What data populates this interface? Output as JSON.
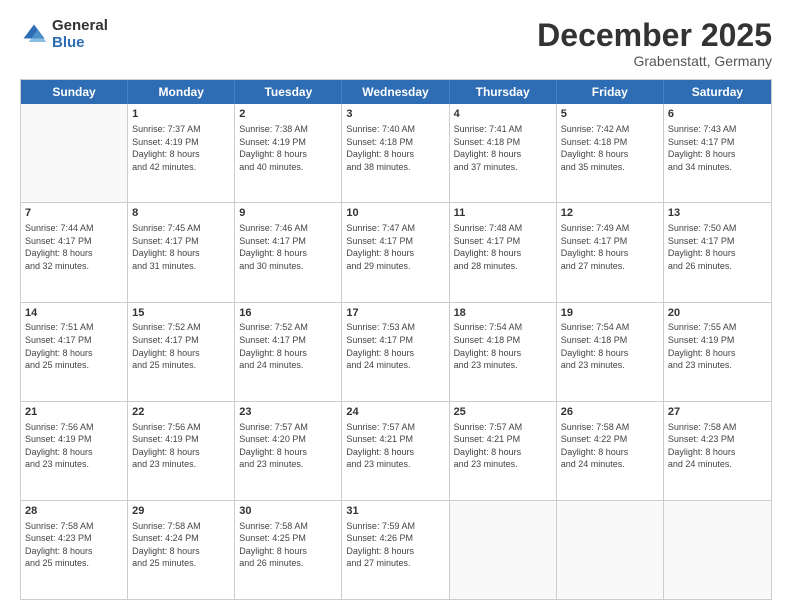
{
  "logo": {
    "general": "General",
    "blue": "Blue"
  },
  "title": "December 2025",
  "subtitle": "Grabenstatt, Germany",
  "header_days": [
    "Sunday",
    "Monday",
    "Tuesday",
    "Wednesday",
    "Thursday",
    "Friday",
    "Saturday"
  ],
  "weeks": [
    [
      {
        "day": "",
        "info": ""
      },
      {
        "day": "1",
        "info": "Sunrise: 7:37 AM\nSunset: 4:19 PM\nDaylight: 8 hours\nand 42 minutes."
      },
      {
        "day": "2",
        "info": "Sunrise: 7:38 AM\nSunset: 4:19 PM\nDaylight: 8 hours\nand 40 minutes."
      },
      {
        "day": "3",
        "info": "Sunrise: 7:40 AM\nSunset: 4:18 PM\nDaylight: 8 hours\nand 38 minutes."
      },
      {
        "day": "4",
        "info": "Sunrise: 7:41 AM\nSunset: 4:18 PM\nDaylight: 8 hours\nand 37 minutes."
      },
      {
        "day": "5",
        "info": "Sunrise: 7:42 AM\nSunset: 4:18 PM\nDaylight: 8 hours\nand 35 minutes."
      },
      {
        "day": "6",
        "info": "Sunrise: 7:43 AM\nSunset: 4:17 PM\nDaylight: 8 hours\nand 34 minutes."
      }
    ],
    [
      {
        "day": "7",
        "info": "Sunrise: 7:44 AM\nSunset: 4:17 PM\nDaylight: 8 hours\nand 32 minutes."
      },
      {
        "day": "8",
        "info": "Sunrise: 7:45 AM\nSunset: 4:17 PM\nDaylight: 8 hours\nand 31 minutes."
      },
      {
        "day": "9",
        "info": "Sunrise: 7:46 AM\nSunset: 4:17 PM\nDaylight: 8 hours\nand 30 minutes."
      },
      {
        "day": "10",
        "info": "Sunrise: 7:47 AM\nSunset: 4:17 PM\nDaylight: 8 hours\nand 29 minutes."
      },
      {
        "day": "11",
        "info": "Sunrise: 7:48 AM\nSunset: 4:17 PM\nDaylight: 8 hours\nand 28 minutes."
      },
      {
        "day": "12",
        "info": "Sunrise: 7:49 AM\nSunset: 4:17 PM\nDaylight: 8 hours\nand 27 minutes."
      },
      {
        "day": "13",
        "info": "Sunrise: 7:50 AM\nSunset: 4:17 PM\nDaylight: 8 hours\nand 26 minutes."
      }
    ],
    [
      {
        "day": "14",
        "info": "Sunrise: 7:51 AM\nSunset: 4:17 PM\nDaylight: 8 hours\nand 25 minutes."
      },
      {
        "day": "15",
        "info": "Sunrise: 7:52 AM\nSunset: 4:17 PM\nDaylight: 8 hours\nand 25 minutes."
      },
      {
        "day": "16",
        "info": "Sunrise: 7:52 AM\nSunset: 4:17 PM\nDaylight: 8 hours\nand 24 minutes."
      },
      {
        "day": "17",
        "info": "Sunrise: 7:53 AM\nSunset: 4:17 PM\nDaylight: 8 hours\nand 24 minutes."
      },
      {
        "day": "18",
        "info": "Sunrise: 7:54 AM\nSunset: 4:18 PM\nDaylight: 8 hours\nand 23 minutes."
      },
      {
        "day": "19",
        "info": "Sunrise: 7:54 AM\nSunset: 4:18 PM\nDaylight: 8 hours\nand 23 minutes."
      },
      {
        "day": "20",
        "info": "Sunrise: 7:55 AM\nSunset: 4:19 PM\nDaylight: 8 hours\nand 23 minutes."
      }
    ],
    [
      {
        "day": "21",
        "info": "Sunrise: 7:56 AM\nSunset: 4:19 PM\nDaylight: 8 hours\nand 23 minutes."
      },
      {
        "day": "22",
        "info": "Sunrise: 7:56 AM\nSunset: 4:19 PM\nDaylight: 8 hours\nand 23 minutes."
      },
      {
        "day": "23",
        "info": "Sunrise: 7:57 AM\nSunset: 4:20 PM\nDaylight: 8 hours\nand 23 minutes."
      },
      {
        "day": "24",
        "info": "Sunrise: 7:57 AM\nSunset: 4:21 PM\nDaylight: 8 hours\nand 23 minutes."
      },
      {
        "day": "25",
        "info": "Sunrise: 7:57 AM\nSunset: 4:21 PM\nDaylight: 8 hours\nand 23 minutes."
      },
      {
        "day": "26",
        "info": "Sunrise: 7:58 AM\nSunset: 4:22 PM\nDaylight: 8 hours\nand 24 minutes."
      },
      {
        "day": "27",
        "info": "Sunrise: 7:58 AM\nSunset: 4:23 PM\nDaylight: 8 hours\nand 24 minutes."
      }
    ],
    [
      {
        "day": "28",
        "info": "Sunrise: 7:58 AM\nSunset: 4:23 PM\nDaylight: 8 hours\nand 25 minutes."
      },
      {
        "day": "29",
        "info": "Sunrise: 7:58 AM\nSunset: 4:24 PM\nDaylight: 8 hours\nand 25 minutes."
      },
      {
        "day": "30",
        "info": "Sunrise: 7:58 AM\nSunset: 4:25 PM\nDaylight: 8 hours\nand 26 minutes."
      },
      {
        "day": "31",
        "info": "Sunrise: 7:59 AM\nSunset: 4:26 PM\nDaylight: 8 hours\nand 27 minutes."
      },
      {
        "day": "",
        "info": ""
      },
      {
        "day": "",
        "info": ""
      },
      {
        "day": "",
        "info": ""
      }
    ]
  ]
}
